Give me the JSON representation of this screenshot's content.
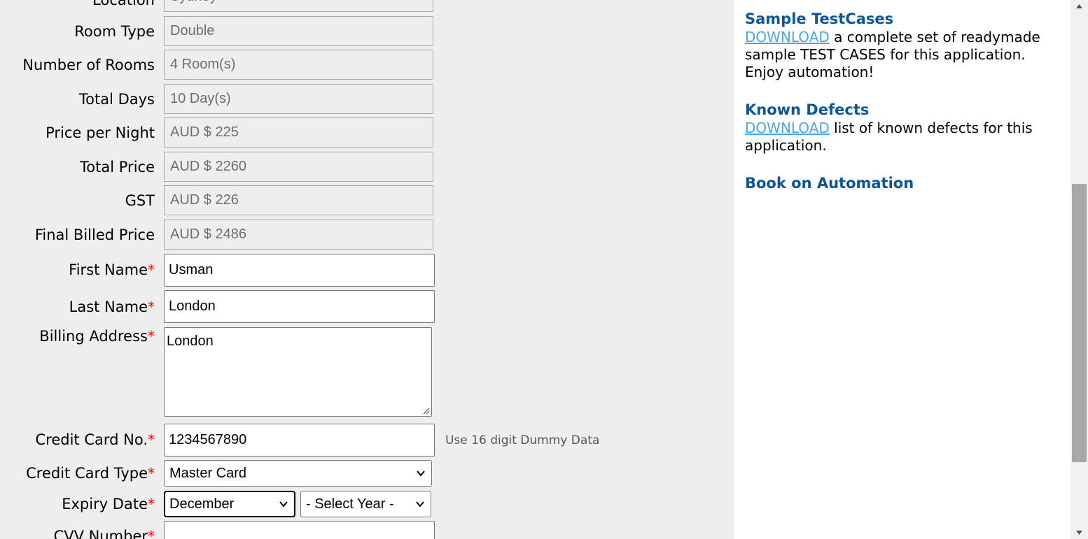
{
  "form": {
    "location": {
      "label": "Location",
      "value": "Sydney"
    },
    "room_type": {
      "label": "Room Type",
      "value": "Double"
    },
    "number_of_rooms": {
      "label": "Number of Rooms",
      "value": "4 Room(s)"
    },
    "total_days": {
      "label": "Total Days",
      "value": "10 Day(s)"
    },
    "price_per_night": {
      "label": "Price per Night",
      "value": "AUD $ 225"
    },
    "total_price": {
      "label": "Total Price",
      "value": "AUD $ 2260"
    },
    "gst": {
      "label": "GST",
      "value": "AUD $ 226"
    },
    "final_billed_price": {
      "label": "Final Billed Price",
      "value": "AUD $ 2486"
    },
    "first_name": {
      "label": "First Name",
      "value": "Usman"
    },
    "last_name": {
      "label": "Last Name",
      "value": "London"
    },
    "billing_address": {
      "label": "Billing Address",
      "value": "London"
    },
    "credit_card_no": {
      "label": "Credit Card No.",
      "value": "1234567890",
      "hint": "Use 16 digit Dummy Data"
    },
    "credit_card_type": {
      "label": "Credit Card Type",
      "value": "Master Card"
    },
    "expiry_date": {
      "label": "Expiry Date",
      "month": "December",
      "year": "- Select Year -"
    },
    "cvv_number": {
      "label": "CVV Number",
      "value": ""
    },
    "required_marker": "*"
  },
  "sidebar": {
    "test_cases": {
      "title": "Sample TestCases",
      "link": "DOWNLOAD",
      "text": " a complete set of readymade sample TEST CASES for this application. Enjoy automation!"
    },
    "known_defects": {
      "title": "Known Defects",
      "link": "DOWNLOAD",
      "text": " list of known defects for this application."
    },
    "book": {
      "title": "Book on Automation"
    }
  },
  "colors": {
    "accent": "#0c5599",
    "link": "#4aa8e8",
    "required": "#ff0000",
    "panel_bg": "#eeeeee"
  }
}
